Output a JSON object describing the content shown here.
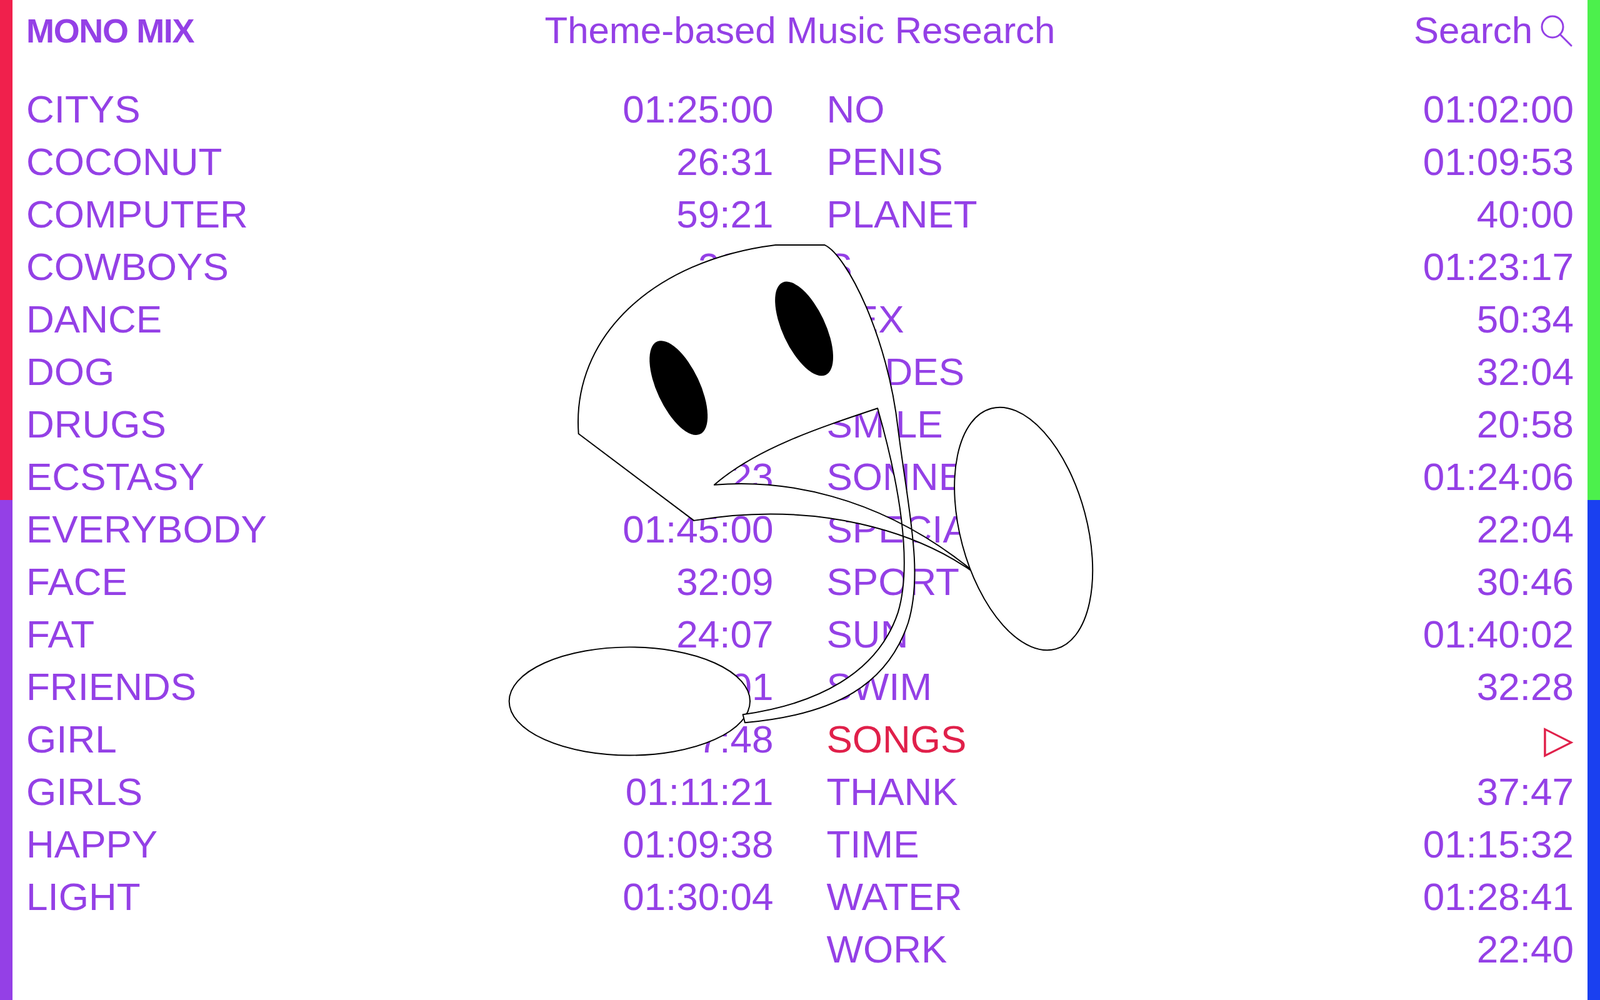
{
  "logo": "MONO MIX",
  "title": "Theme-based Music Research",
  "search": {
    "label": "Search"
  },
  "columns": [
    [
      {
        "name": "CITYS",
        "duration": "01:25:00",
        "selected": false
      },
      {
        "name": "COCONUT",
        "duration": "26:31",
        "selected": false
      },
      {
        "name": "COMPUTER",
        "duration": "59:21",
        "selected": false
      },
      {
        "name": "COWBOYS",
        "duration": "23:5",
        "selected": false
      },
      {
        "name": "DANCE",
        "duration": "",
        "selected": false
      },
      {
        "name": "DOG",
        "duration": "",
        "selected": false
      },
      {
        "name": "DRUGS",
        "duration": "",
        "selected": false
      },
      {
        "name": "ECSTASY",
        "duration": "23",
        "selected": false
      },
      {
        "name": "EVERYBODY",
        "duration": "01:45:00",
        "selected": false
      },
      {
        "name": "FACE",
        "duration": "32:09",
        "selected": false
      },
      {
        "name": "FAT",
        "duration": "24:07",
        "selected": false
      },
      {
        "name": "FRIENDS",
        "duration": "01",
        "selected": false
      },
      {
        "name": "GIRL",
        "duration": "7:48",
        "selected": false
      },
      {
        "name": "GIRLS",
        "duration": "01:11:21",
        "selected": false
      },
      {
        "name": "HAPPY",
        "duration": "01:09:38",
        "selected": false
      },
      {
        "name": "LIGHT",
        "duration": "01:30:04",
        "selected": false
      }
    ],
    [
      {
        "name": "NO",
        "duration": "01:02:00",
        "selected": false
      },
      {
        "name": "PENIS",
        "duration": "01:09:53",
        "selected": false
      },
      {
        "name": "PLANET",
        "duration": "40:00",
        "selected": false
      },
      {
        "name": "S",
        "duration": "01:23:17",
        "selected": false
      },
      {
        "name": "SEX",
        "duration": "50:34",
        "selected": false
      },
      {
        "name": "SLIDES",
        "duration": "32:04",
        "selected": false
      },
      {
        "name": "SMILE",
        "duration": "20:58",
        "selected": false
      },
      {
        "name": "SONNE",
        "duration": "01:24:06",
        "selected": false
      },
      {
        "name": "SPECIAL",
        "duration": "22:04",
        "selected": false
      },
      {
        "name": "SPORT",
        "duration": "30:46",
        "selected": false
      },
      {
        "name": "SUN",
        "duration": "01:40:02",
        "selected": false
      },
      {
        "name": "SWIM",
        "duration": "32:28",
        "selected": false
      },
      {
        "name": "SONGS",
        "duration": "▷",
        "selected": true
      },
      {
        "name": "THANK",
        "duration": "37:47",
        "selected": false
      },
      {
        "name": "TIME",
        "duration": "01:15:32",
        "selected": false
      },
      {
        "name": "WATER",
        "duration": "01:28:41",
        "selected": false
      },
      {
        "name": "WORK",
        "duration": "22:40",
        "selected": false
      }
    ]
  ]
}
